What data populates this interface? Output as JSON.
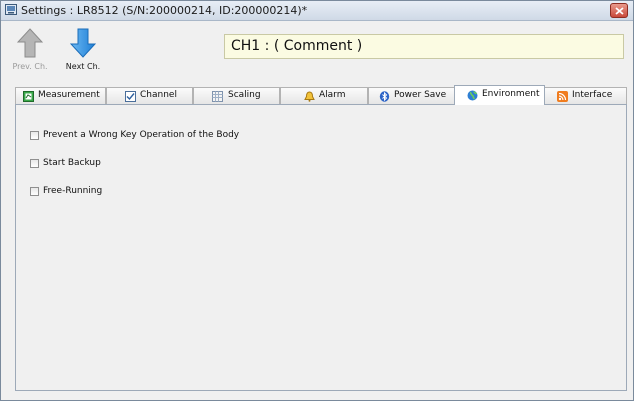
{
  "window": {
    "title": "Settings : LR8512 (S/N:200000214, ID:200000214)*"
  },
  "toolbar": {
    "prev_label": "Prev. Ch.",
    "next_label": "Next Ch.",
    "comment": "CH1 : ( Comment )"
  },
  "tabs": [
    {
      "label": "Measurement",
      "icon": "measurement-icon"
    },
    {
      "label": "Channel",
      "icon": "channel-check-icon"
    },
    {
      "label": "Scaling",
      "icon": "scaling-icon"
    },
    {
      "label": "Alarm",
      "icon": "bell-icon"
    },
    {
      "label": "Power Save",
      "icon": "bluetooth-icon"
    },
    {
      "label": "Environment",
      "icon": "globe-icon",
      "active": true
    },
    {
      "label": "Interface",
      "icon": "rss-icon"
    }
  ],
  "environment": {
    "options": [
      {
        "label": "Prevent a Wrong Key Operation of the Body",
        "checked": false
      },
      {
        "label": "Start Backup",
        "checked": false
      },
      {
        "label": "Free-Running",
        "checked": false
      }
    ]
  },
  "colors": {
    "comment_bg": "#fbfbe2",
    "arrow_blue": "#2f8fe0",
    "arrow_gray": "#9a9a9a",
    "close_red": "#c9483a"
  }
}
